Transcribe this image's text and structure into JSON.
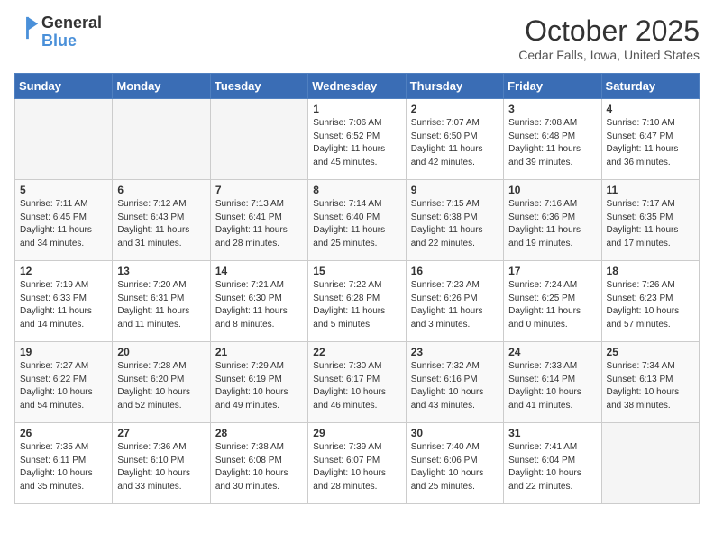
{
  "header": {
    "logo_line1": "General",
    "logo_line2": "Blue",
    "month_title": "October 2025",
    "location": "Cedar Falls, Iowa, United States"
  },
  "days_of_week": [
    "Sunday",
    "Monday",
    "Tuesday",
    "Wednesday",
    "Thursday",
    "Friday",
    "Saturday"
  ],
  "weeks": [
    [
      {
        "day": "",
        "info": ""
      },
      {
        "day": "",
        "info": ""
      },
      {
        "day": "",
        "info": ""
      },
      {
        "day": "1",
        "info": "Sunrise: 7:06 AM\nSunset: 6:52 PM\nDaylight: 11 hours\nand 45 minutes."
      },
      {
        "day": "2",
        "info": "Sunrise: 7:07 AM\nSunset: 6:50 PM\nDaylight: 11 hours\nand 42 minutes."
      },
      {
        "day": "3",
        "info": "Sunrise: 7:08 AM\nSunset: 6:48 PM\nDaylight: 11 hours\nand 39 minutes."
      },
      {
        "day": "4",
        "info": "Sunrise: 7:10 AM\nSunset: 6:47 PM\nDaylight: 11 hours\nand 36 minutes."
      }
    ],
    [
      {
        "day": "5",
        "info": "Sunrise: 7:11 AM\nSunset: 6:45 PM\nDaylight: 11 hours\nand 34 minutes."
      },
      {
        "day": "6",
        "info": "Sunrise: 7:12 AM\nSunset: 6:43 PM\nDaylight: 11 hours\nand 31 minutes."
      },
      {
        "day": "7",
        "info": "Sunrise: 7:13 AM\nSunset: 6:41 PM\nDaylight: 11 hours\nand 28 minutes."
      },
      {
        "day": "8",
        "info": "Sunrise: 7:14 AM\nSunset: 6:40 PM\nDaylight: 11 hours\nand 25 minutes."
      },
      {
        "day": "9",
        "info": "Sunrise: 7:15 AM\nSunset: 6:38 PM\nDaylight: 11 hours\nand 22 minutes."
      },
      {
        "day": "10",
        "info": "Sunrise: 7:16 AM\nSunset: 6:36 PM\nDaylight: 11 hours\nand 19 minutes."
      },
      {
        "day": "11",
        "info": "Sunrise: 7:17 AM\nSunset: 6:35 PM\nDaylight: 11 hours\nand 17 minutes."
      }
    ],
    [
      {
        "day": "12",
        "info": "Sunrise: 7:19 AM\nSunset: 6:33 PM\nDaylight: 11 hours\nand 14 minutes."
      },
      {
        "day": "13",
        "info": "Sunrise: 7:20 AM\nSunset: 6:31 PM\nDaylight: 11 hours\nand 11 minutes."
      },
      {
        "day": "14",
        "info": "Sunrise: 7:21 AM\nSunset: 6:30 PM\nDaylight: 11 hours\nand 8 minutes."
      },
      {
        "day": "15",
        "info": "Sunrise: 7:22 AM\nSunset: 6:28 PM\nDaylight: 11 hours\nand 5 minutes."
      },
      {
        "day": "16",
        "info": "Sunrise: 7:23 AM\nSunset: 6:26 PM\nDaylight: 11 hours\nand 3 minutes."
      },
      {
        "day": "17",
        "info": "Sunrise: 7:24 AM\nSunset: 6:25 PM\nDaylight: 11 hours\nand 0 minutes."
      },
      {
        "day": "18",
        "info": "Sunrise: 7:26 AM\nSunset: 6:23 PM\nDaylight: 10 hours\nand 57 minutes."
      }
    ],
    [
      {
        "day": "19",
        "info": "Sunrise: 7:27 AM\nSunset: 6:22 PM\nDaylight: 10 hours\nand 54 minutes."
      },
      {
        "day": "20",
        "info": "Sunrise: 7:28 AM\nSunset: 6:20 PM\nDaylight: 10 hours\nand 52 minutes."
      },
      {
        "day": "21",
        "info": "Sunrise: 7:29 AM\nSunset: 6:19 PM\nDaylight: 10 hours\nand 49 minutes."
      },
      {
        "day": "22",
        "info": "Sunrise: 7:30 AM\nSunset: 6:17 PM\nDaylight: 10 hours\nand 46 minutes."
      },
      {
        "day": "23",
        "info": "Sunrise: 7:32 AM\nSunset: 6:16 PM\nDaylight: 10 hours\nand 43 minutes."
      },
      {
        "day": "24",
        "info": "Sunrise: 7:33 AM\nSunset: 6:14 PM\nDaylight: 10 hours\nand 41 minutes."
      },
      {
        "day": "25",
        "info": "Sunrise: 7:34 AM\nSunset: 6:13 PM\nDaylight: 10 hours\nand 38 minutes."
      }
    ],
    [
      {
        "day": "26",
        "info": "Sunrise: 7:35 AM\nSunset: 6:11 PM\nDaylight: 10 hours\nand 35 minutes."
      },
      {
        "day": "27",
        "info": "Sunrise: 7:36 AM\nSunset: 6:10 PM\nDaylight: 10 hours\nand 33 minutes."
      },
      {
        "day": "28",
        "info": "Sunrise: 7:38 AM\nSunset: 6:08 PM\nDaylight: 10 hours\nand 30 minutes."
      },
      {
        "day": "29",
        "info": "Sunrise: 7:39 AM\nSunset: 6:07 PM\nDaylight: 10 hours\nand 28 minutes."
      },
      {
        "day": "30",
        "info": "Sunrise: 7:40 AM\nSunset: 6:06 PM\nDaylight: 10 hours\nand 25 minutes."
      },
      {
        "day": "31",
        "info": "Sunrise: 7:41 AM\nSunset: 6:04 PM\nDaylight: 10 hours\nand 22 minutes."
      },
      {
        "day": "",
        "info": ""
      }
    ]
  ]
}
